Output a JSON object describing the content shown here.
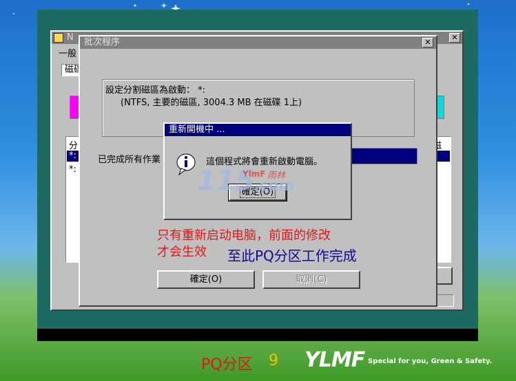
{
  "back_window": {
    "title_fragment": "N",
    "menu_fragment": "一般",
    "tab_fragment": "磁碟",
    "list_header_left": "分",
    "list_header_right": "磁",
    "list_rows": [
      "*:",
      "*:"
    ]
  },
  "batch_dialog": {
    "title": "批次程序",
    "line1": "設定分割磁區為啟動： *:",
    "line2": "(NTFS, 主要的磁區, 3004.3 MB 在磁碟 1上)",
    "status_label": "已完成所有作業",
    "ok_label": "確定(O)",
    "cancel_label": "取消(C)"
  },
  "restart_dialog": {
    "title": "重新開機中 ...",
    "message": "這個程式將會重新啟動電腦。",
    "ok_label": "確定(O)"
  },
  "watermark": {
    "digits": "115",
    "brand": "YlmF",
    "brand_cn": "雨林",
    "com": ".com"
  },
  "annotations": {
    "red_line1": "只有重新启动电脑，前面的修改",
    "red_line2": "才会生效",
    "blue_text": "至此PQ分区工作完成"
  },
  "footer": {
    "caption": "PQ分区",
    "page_number": "9",
    "logo_text": "YLMF",
    "slogan": "Special for you, Green & Safety."
  },
  "colors": {
    "title_active": "#00007b",
    "title_inactive": "#808080",
    "window_face": "#c0c0c0",
    "red_annotation": "#e01818",
    "blue_annotation": "#0d0d8c",
    "caption_red": "#e8141b",
    "page_number_yellow": "#f2c200"
  }
}
